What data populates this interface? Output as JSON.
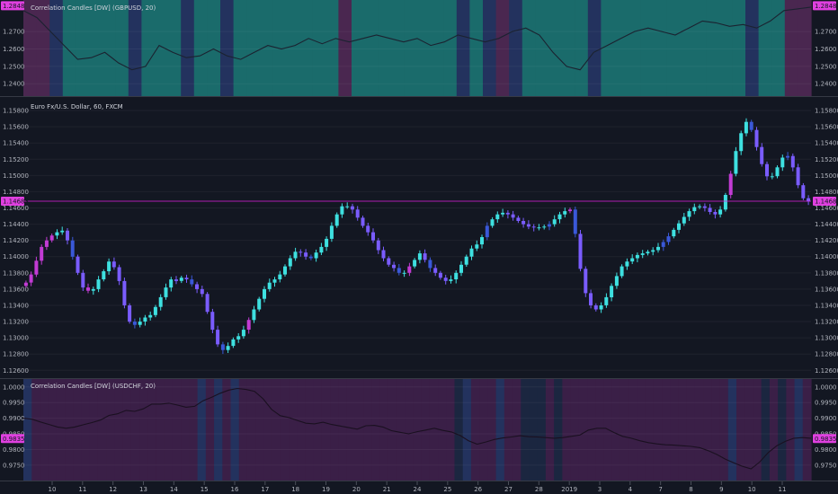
{
  "chart_data": [
    {
      "type": "line",
      "title": "Correlation Candles [DW] (GBPUSD, 20)",
      "yticks": [
        "1.2700",
        "1.2600",
        "1.2500",
        "1.2400"
      ],
      "ylim": [
        1.236,
        1.285
      ],
      "last_value": "1.2848",
      "series": [
        {
          "values": [
            1.282,
            1.278,
            1.27,
            1.262,
            1.254,
            1.255,
            1.258,
            1.252,
            1.248,
            1.25,
            1.262,
            1.258,
            1.255,
            1.256,
            1.26,
            1.256,
            1.254,
            1.258,
            1.262,
            1.26,
            1.262,
            1.266,
            1.263,
            1.266,
            1.264,
            1.266,
            1.268,
            1.266,
            1.264,
            1.266,
            1.262,
            1.264,
            1.268,
            1.266,
            1.264,
            1.266,
            1.27,
            1.272,
            1.268,
            1.258,
            1.25,
            1.248,
            1.258,
            1.262,
            1.266,
            1.27,
            1.272,
            1.27,
            1.268,
            1.272,
            1.276,
            1.275,
            1.273,
            1.274,
            1.272,
            1.276,
            1.282,
            1.283,
            1.284
          ]
        }
      ],
      "band_colors": {
        "green": "#1a6b6b",
        "blue": "#23325e",
        "purple": "#4a2750"
      },
      "bands": [
        "purple",
        "purple",
        "blue",
        "green",
        "green",
        "green",
        "green",
        "green",
        "blue",
        "green",
        "green",
        "green",
        "blue",
        "green",
        "green",
        "blue",
        "green",
        "green",
        "green",
        "green",
        "green",
        "green",
        "green",
        "green",
        "purple",
        "green",
        "green",
        "green",
        "green",
        "green",
        "green",
        "green",
        "green",
        "blue",
        "green",
        "blue",
        "purple",
        "blue",
        "green",
        "green",
        "green",
        "green",
        "green",
        "blue",
        "green",
        "green",
        "green",
        "green",
        "green",
        "green",
        "green",
        "green",
        "green",
        "green",
        "green",
        "blue",
        "green",
        "green",
        "purple",
        "purple"
      ]
    },
    {
      "type": "candlestick",
      "title": "Euro Fx/U.S. Dollar, 60, FXCM",
      "yticks": [
        "1.15800",
        "1.15600",
        "1.15400",
        "1.15200",
        "1.15000",
        "1.14800",
        "1.14600",
        "1.14400",
        "1.14200",
        "1.14000",
        "1.13800",
        "1.13600",
        "1.13400",
        "1.13200",
        "1.13000",
        "1.12800",
        "1.12600"
      ],
      "ylim": [
        1.1257,
        1.159
      ],
      "last_value": "1.14683",
      "colors": {
        "bull": "#3ee0e0",
        "bear": "#7a5cff",
        "neutral": "#3a58d8",
        "accent": "#c23bd4",
        "price_line": "#e020e0"
      },
      "closes": [
        1.1368,
        1.1378,
        1.1395,
        1.1412,
        1.142,
        1.1426,
        1.143,
        1.1432,
        1.142,
        1.14,
        1.138,
        1.1362,
        1.1358,
        1.136,
        1.1372,
        1.1382,
        1.1394,
        1.1387,
        1.137,
        1.134,
        1.132,
        1.1316,
        1.132,
        1.1325,
        1.1328,
        1.1338,
        1.135,
        1.1362,
        1.1372,
        1.137,
        1.1374,
        1.1372,
        1.1366,
        1.136,
        1.1354,
        1.1332,
        1.131,
        1.1292,
        1.1285,
        1.129,
        1.1298,
        1.1302,
        1.131,
        1.1322,
        1.1335,
        1.1348,
        1.136,
        1.1368,
        1.1372,
        1.1378,
        1.1388,
        1.1398,
        1.1406,
        1.1405,
        1.14,
        1.1398,
        1.1405,
        1.1412,
        1.1422,
        1.1438,
        1.1452,
        1.1462,
        1.1462,
        1.1458,
        1.1448,
        1.1438,
        1.143,
        1.142,
        1.1408,
        1.1398,
        1.139,
        1.1386,
        1.138,
        1.138,
        1.1388,
        1.1396,
        1.1404,
        1.1396,
        1.1386,
        1.138,
        1.1374,
        1.137,
        1.1372,
        1.138,
        1.139,
        1.14,
        1.141,
        1.1415,
        1.1424,
        1.1438,
        1.1446,
        1.1452,
        1.1454,
        1.1452,
        1.1448,
        1.1444,
        1.144,
        1.1437,
        1.1436,
        1.1436,
        1.1437,
        1.144,
        1.1446,
        1.1452,
        1.1456,
        1.1458,
        1.1428,
        1.1385,
        1.1355,
        1.134,
        1.1335,
        1.134,
        1.135,
        1.1364,
        1.1376,
        1.1388,
        1.1394,
        1.1398,
        1.1402,
        1.1404,
        1.1406,
        1.1408,
        1.1412,
        1.1418,
        1.1425,
        1.1433,
        1.1441,
        1.1449,
        1.1456,
        1.1461,
        1.1462,
        1.146,
        1.1455,
        1.1452,
        1.1458,
        1.1476,
        1.1502,
        1.153,
        1.1552,
        1.1566,
        1.1556,
        1.1535,
        1.1514,
        1.1499,
        1.1499,
        1.151,
        1.1522,
        1.1524,
        1.151,
        1.1488,
        1.1472,
        1.1468
      ]
    },
    {
      "type": "line",
      "title": "Correlation Candles [DW] (USDCHF, 20)",
      "yticks": [
        "1.0000",
        "0.9950",
        "0.9900",
        "0.9850",
        "0.9800",
        "0.9750"
      ],
      "ylim": [
        0.9718,
        1.0008
      ],
      "last_value": "0.9835",
      "series": [
        {
          "values": [
            0.99,
            0.9897,
            0.9888,
            0.988,
            0.9872,
            0.9868,
            0.9872,
            0.9879,
            0.9886,
            0.9894,
            0.9909,
            0.9914,
            0.9925,
            0.9922,
            0.993,
            0.9945,
            0.9945,
            0.9948,
            0.9942,
            0.9935,
            0.9938,
            0.9956,
            0.9967,
            0.998,
            0.999,
            0.9995,
            0.9992,
            0.9986,
            0.9962,
            0.9928,
            0.9908,
            0.9902,
            0.9893,
            0.9884,
            0.9882,
            0.9887,
            0.988,
            0.9875,
            0.987,
            0.9865,
            0.9876,
            0.9877,
            0.9872,
            0.986,
            0.9855,
            0.985,
            0.9857,
            0.9862,
            0.9868,
            0.9861,
            0.9856,
            0.9845,
            0.9828,
            0.9817,
            0.9824,
            0.9832,
            0.9837,
            0.984,
            0.9844,
            0.9841,
            0.984,
            0.9838,
            0.9836,
            0.9838,
            0.9842,
            0.9846,
            0.9862,
            0.9868,
            0.9868,
            0.9854,
            0.9842,
            0.9836,
            0.9828,
            0.9822,
            0.9818,
            0.9815,
            0.9814,
            0.9812,
            0.981,
            0.9806,
            0.9796,
            0.9784,
            0.9769,
            0.9757,
            0.9746,
            0.9738,
            0.976,
            0.979,
            0.9812,
            0.9826,
            0.9836,
            0.9838,
            0.9836
          ]
        }
      ],
      "band_colors": {
        "purple": "#3a1f47",
        "blue": "#23325e",
        "navy": "#1b2640"
      },
      "bands": [
        "blue",
        "purple",
        "purple",
        "purple",
        "purple",
        "purple",
        "purple",
        "purple",
        "purple",
        "purple",
        "purple",
        "purple",
        "purple",
        "purple",
        "purple",
        "purple",
        "purple",
        "purple",
        "purple",
        "purple",
        "purple",
        "blue",
        "purple",
        "blue",
        "purple",
        "blue",
        "purple",
        "purple",
        "purple",
        "purple",
        "purple",
        "purple",
        "purple",
        "purple",
        "purple",
        "purple",
        "purple",
        "purple",
        "purple",
        "purple",
        "purple",
        "purple",
        "purple",
        "purple",
        "purple",
        "purple",
        "purple",
        "purple",
        "purple",
        "purple",
        "purple",
        "purple",
        "navy",
        "blue",
        "purple",
        "purple",
        "purple",
        "blue",
        "purple",
        "purple",
        "navy",
        "navy",
        "navy",
        "purple",
        "navy",
        "purple",
        "purple",
        "purple",
        "purple",
        "purple",
        "purple",
        "purple",
        "purple",
        "purple",
        "purple",
        "purple",
        "purple",
        "purple",
        "purple",
        "purple",
        "purple",
        "purple",
        "purple",
        "purple",
        "purple",
        "blue",
        "purple",
        "purple",
        "purple",
        "navy",
        "purple",
        "navy",
        "purple",
        "blue",
        "purple"
      ]
    }
  ],
  "x_axis": {
    "labels": [
      "10",
      "11",
      "12",
      "13",
      "14",
      "15",
      "16",
      "17",
      "18",
      "19",
      "20",
      "21",
      "24",
      "25",
      "26",
      "27",
      "28",
      "2019",
      "3",
      "4",
      "7",
      "8",
      "9",
      "10",
      "11"
    ]
  },
  "badge_color": "#e040e0"
}
